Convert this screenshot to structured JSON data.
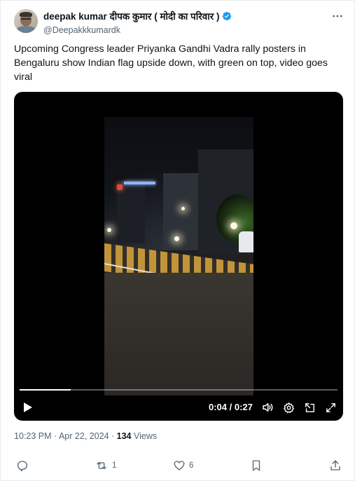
{
  "author": {
    "display_name": "deepak kumar दीपक कुमार ( मोदी का परिवार )",
    "handle": "@Deepakkkumardk",
    "verified": true
  },
  "tweet": {
    "text": "Upcoming Congress leader Priyanka Gandhi Vadra rally posters in Bengaluru show Indian flag upside down, with green on top, video goes viral"
  },
  "video": {
    "current_time": "0:04",
    "separator": " / ",
    "duration": "0:27",
    "progress_fraction": 0.16
  },
  "meta": {
    "time": "10:23 PM",
    "date": "Apr 22, 2024",
    "dot": " · ",
    "views_count": "134",
    "views_label": " Views"
  },
  "actions": {
    "replies": "",
    "reposts": "1",
    "likes": "6"
  },
  "icons": {
    "verified_color": "#1d9bf0",
    "text_secondary": "#536471"
  }
}
